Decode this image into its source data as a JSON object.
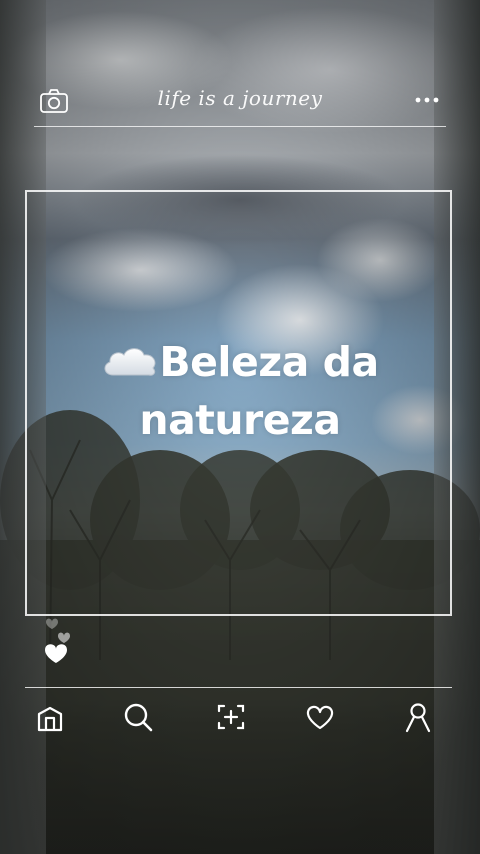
{
  "header": {
    "title": "life is a journey",
    "left_icon": "camera-icon",
    "right_icon": "more-options-icon"
  },
  "post": {
    "caption_emoji": "cloud-icon",
    "caption_line1": "Beleza da",
    "caption_line2": "natureza"
  },
  "reactions": {
    "icons": [
      "heart-icon",
      "heart-icon",
      "heart-icon"
    ]
  },
  "bottom_nav": {
    "items": [
      {
        "name": "home",
        "icon": "home-icon"
      },
      {
        "name": "search",
        "icon": "search-icon"
      },
      {
        "name": "add",
        "icon": "add-post-icon"
      },
      {
        "name": "likes",
        "icon": "heart-icon"
      },
      {
        "name": "profile",
        "icon": "profile-icon"
      }
    ]
  },
  "colors": {
    "overlay_line": "#ffffff",
    "sky_blue": "#8eb1cc",
    "foliage": "#3b3d36"
  }
}
